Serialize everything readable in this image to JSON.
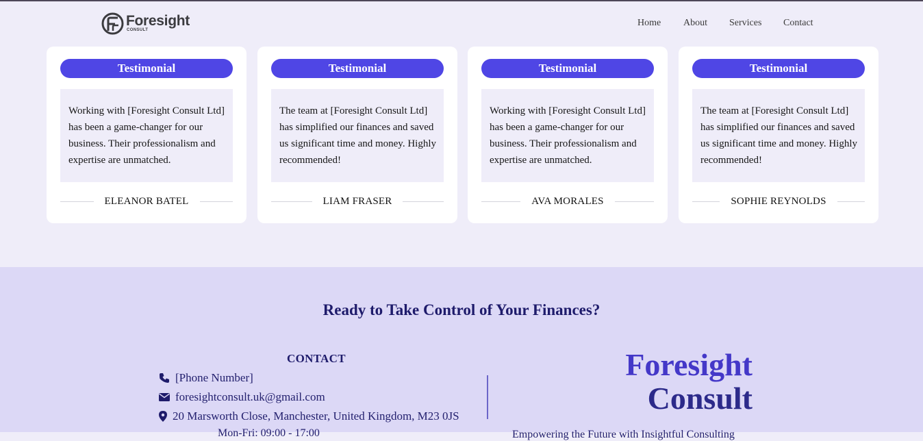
{
  "header": {
    "logo_name": "Foresight",
    "logo_sub": "CONSULT",
    "nav": [
      "Home",
      "About",
      "Services",
      "Contact"
    ]
  },
  "testimonials": [
    {
      "badge": "Testimonial",
      "quote": "Working with [Foresight Consult Ltd] has been a game-changer for our business. Their professionalism and expertise are unmatched.",
      "author": "ELEANOR BATEL"
    },
    {
      "badge": "Testimonial",
      "quote": "The team at [Foresight Consult Ltd] has simplified our finances and saved us significant time and money. Highly recommended!",
      "author": "LIAM FRASER"
    },
    {
      "badge": "Testimonial",
      "quote": "Working with [Foresight Consult Ltd] has been a game-changer for our business. Their professionalism and expertise are unmatched.",
      "author": "AVA MORALES"
    },
    {
      "badge": "Testimonial",
      "quote": "The team at [Foresight Consult Ltd] has simplified our finances and saved us significant time and money. Highly recommended!",
      "author": "SOPHIE REYNOLDS"
    }
  ],
  "cta": {
    "title": "Ready to Take Control of Your Finances?",
    "contact_heading": "CONTACT",
    "phone": "[Phone Number]",
    "email": "foresightconsult.uk@gmail.com",
    "address": "20 Marsworth Close, Manchester, United Kingdom, M23 0JS",
    "hours_partial": "Mon-Fri: 09:00 - 17:00",
    "brand_line1": "Foresight",
    "brand_line2": "Consult",
    "tagline_partial": "Empowering the Future with Insightful Consulting"
  },
  "colors": {
    "accent": "#4f46e5",
    "page_bg": "#efedf9",
    "cta_bg": "#dcd8f6",
    "heading": "#1e1b6b"
  },
  "icons": [
    "foresight-logo-icon",
    "phone-icon",
    "envelope-icon",
    "map-pin-icon"
  ]
}
